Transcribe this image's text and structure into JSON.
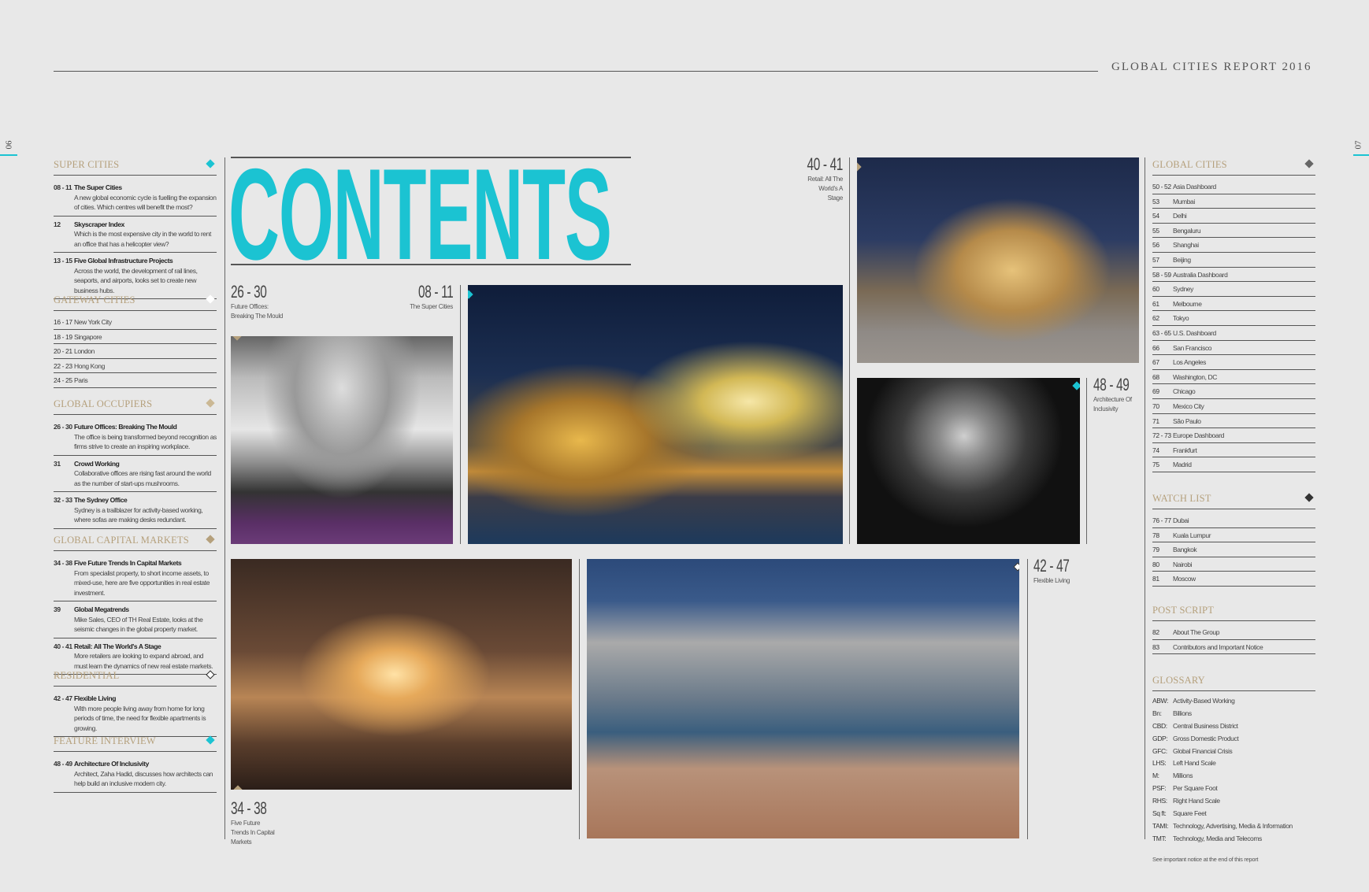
{
  "header": {
    "title": "GLOBAL CITIES REPORT 2016",
    "page_left": "06",
    "page_right": "07"
  },
  "contents_title": "CONTENTS",
  "colors": {
    "teal": "#1bc3d2",
    "gold": "#b5a07c",
    "dark": "#555555"
  },
  "left_sections": [
    {
      "heading": "Super Cities",
      "diamond": "teal",
      "entries": [
        {
          "page": "08 - 11",
          "title": "The Super Cities",
          "desc": "A new global economic cycle is fuelling the expansion of cities. Which centres will benefit the most?"
        },
        {
          "page": "12",
          "title": "Skyscraper Index",
          "desc": "Which is the most expensive city in the world to rent an office that has a helicopter view?"
        },
        {
          "page": "13 - 15",
          "title": "Five Global Infrastructure Projects",
          "desc": "Across the world, the development of rail lines, seaports, and airports, looks set to create new business hubs."
        }
      ]
    },
    {
      "heading": "Gateway Cities",
      "diamond": "white",
      "rows": [
        {
          "page": "16 - 17",
          "title": "New York City"
        },
        {
          "page": "18 - 19",
          "title": "Singapore"
        },
        {
          "page": "20 - 21",
          "title": "London"
        },
        {
          "page": "22 - 23",
          "title": "Hong Kong"
        },
        {
          "page": "24 - 25",
          "title": "Paris"
        }
      ]
    },
    {
      "heading": "Global Occupiers",
      "diamond": "gold-light",
      "entries": [
        {
          "page": "26 - 30",
          "title": "Future Offices: Breaking The Mould",
          "desc": "The office is being transformed beyond recognition as firms strive to create an inspiring workplace."
        },
        {
          "page": "31",
          "title": "Crowd Working",
          "desc": "Collaborative offices are rising fast around the world as the number of start-ups mushrooms."
        },
        {
          "page": "32 - 33",
          "title": "The Sydney Office",
          "desc": "Sydney is a trailblazer for activity-based working, where sofas are making desks redundant."
        }
      ]
    },
    {
      "heading": "Global Capital Markets",
      "diamond": "gold",
      "entries": [
        {
          "page": "34 - 38",
          "title": "Five Future Trends In Capital Markets",
          "desc": "From specialist property, to short income assets, to mixed-use, here are five opportunities in real estate investment."
        },
        {
          "page": "39",
          "title": "Global Megatrends",
          "desc": "Mike Sales, CEO of TH Real Estate, looks at the seismic changes in the global property market."
        },
        {
          "page": "40 - 41",
          "title": "Retail: All The World's A Stage",
          "desc": "More retailers are looking to expand abroad, and must learn the dynamics of new real estate markets."
        }
      ]
    },
    {
      "heading": "Residential",
      "diamond": "outline",
      "entries": [
        {
          "page": "42 - 47",
          "title": "Flexible Living",
          "desc": "With more people living away from home for long periods of time, the need for flexible apartments is growing."
        }
      ]
    },
    {
      "heading": "Feature Interview",
      "diamond": "teal",
      "entries": [
        {
          "page": "48 - 49",
          "title": "Architecture Of Inclusivity",
          "desc": "Architect, Zaha Hadid, discusses how architects can help build an inclusive modern city."
        }
      ]
    }
  ],
  "right_sections": [
    {
      "heading": "Global Cities",
      "diamond": "grey",
      "rows": [
        {
          "page": "50 - 52",
          "title": "Asia Dashboard"
        },
        {
          "page": "53",
          "title": "Mumbai"
        },
        {
          "page": "54",
          "title": "Delhi"
        },
        {
          "page": "55",
          "title": "Bengaluru"
        },
        {
          "page": "56",
          "title": "Shanghai"
        },
        {
          "page": "57",
          "title": "Beijing"
        },
        {
          "page": "58 - 59",
          "title": "Australia Dashboard"
        },
        {
          "page": "60",
          "title": "Sydney"
        },
        {
          "page": "61",
          "title": "Melbourne"
        },
        {
          "page": "62",
          "title": "Tokyo"
        },
        {
          "page": "63 - 65",
          "title": "U.S. Dashboard"
        },
        {
          "page": "66",
          "title": "San Francisco"
        },
        {
          "page": "67",
          "title": "Los Angeles"
        },
        {
          "page": "68",
          "title": "Washington, DC"
        },
        {
          "page": "69",
          "title": "Chicago"
        },
        {
          "page": "70",
          "title": "Mexico City"
        },
        {
          "page": "71",
          "title": "São Paulo"
        },
        {
          "page": "72 - 73",
          "title": "Europe Dashboard"
        },
        {
          "page": "74",
          "title": "Frankfurt"
        },
        {
          "page": "75",
          "title": "Madrid"
        }
      ]
    },
    {
      "heading": "Watch List",
      "diamond": "dark",
      "rows": [
        {
          "page": "76 - 77",
          "title": "Dubai"
        },
        {
          "page": "78",
          "title": "Kuala Lumpur"
        },
        {
          "page": "79",
          "title": "Bangkok"
        },
        {
          "page": "80",
          "title": "Nairobi"
        },
        {
          "page": "81",
          "title": "Moscow"
        }
      ]
    },
    {
      "heading": "Post Script",
      "diamond": "none",
      "rows": [
        {
          "page": "82",
          "title": "About The Group"
        },
        {
          "page": "83",
          "title": "Contributors and Important Notice"
        }
      ]
    },
    {
      "heading": "Glossary",
      "diamond": "none",
      "glossary": [
        {
          "page": "ABW:",
          "title": "Activity-Based Working"
        },
        {
          "page": "Bn:",
          "title": "Billions"
        },
        {
          "page": "CBD:",
          "title": "Central Business District"
        },
        {
          "page": "GDP:",
          "title": "Gross Domestic Product"
        },
        {
          "page": "GFC:",
          "title": "Global Financial Crisis"
        },
        {
          "page": "LHS:",
          "title": "Left Hand Scale"
        },
        {
          "page": "M:",
          "title": "Millions"
        },
        {
          "page": "PSF:",
          "title": "Per Square Foot"
        },
        {
          "page": "RHS:",
          "title": "Right Hand Scale"
        },
        {
          "page": "Sq ft:",
          "title": "Square Feet"
        },
        {
          "page": "TAMI:",
          "title": "Technology, Advertising, Media & Information"
        },
        {
          "page": "TMT:",
          "title": "Technology, Media and Telecoms"
        }
      ]
    }
  ],
  "footnote": "See important notice at the end of this report",
  "features": {
    "f1": {
      "page": "26 - 30",
      "caption": "Future Offices: Breaking The Mould"
    },
    "f2": {
      "page": "08 - 11",
      "caption": "The Super Cities"
    },
    "f3": {
      "page": "40 - 41",
      "caption": "Retail: All The World's A Stage"
    },
    "f4": {
      "page": "48 - 49",
      "caption": "Architecture Of Inclusivity"
    },
    "f5": {
      "page": "34 - 38",
      "caption": "Five Future Trends In Capital Markets"
    },
    "f6": {
      "page": "42 - 47",
      "caption": "Flexible Living"
    }
  }
}
